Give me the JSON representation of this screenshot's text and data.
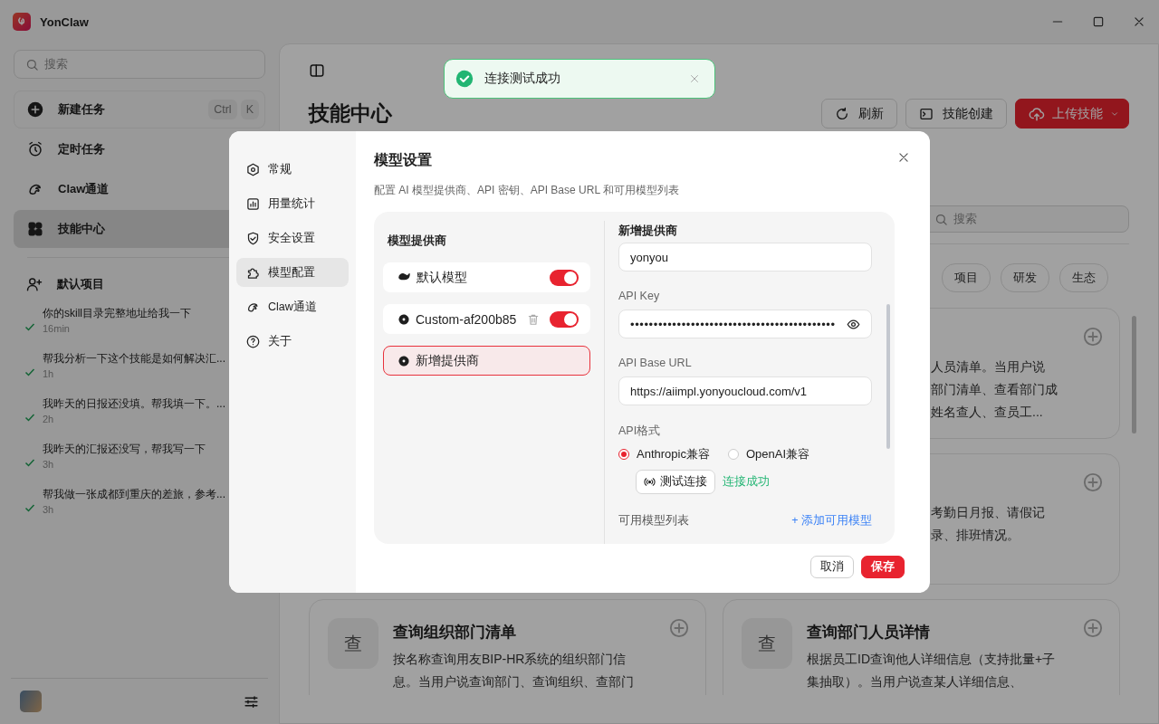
{
  "app": {
    "title": "YonClaw"
  },
  "toast": {
    "message": "连接测试成功"
  },
  "sidebar": {
    "search": {
      "placeholder": "搜索"
    },
    "nav": [
      {
        "label": "新建任务",
        "selected": false,
        "shortcut": [
          "Ctrl",
          "K"
        ]
      },
      {
        "label": "定时任务",
        "selected": false
      },
      {
        "label": "Claw通道",
        "selected": false
      },
      {
        "label": "技能中心",
        "selected": true
      }
    ],
    "project": "默认项目",
    "sessions": [
      {
        "title": "你的skill目录完整地址给我一下",
        "time": "16min",
        "done": true
      },
      {
        "title": "帮我分析一下这个技能是如何解决汇...",
        "time": "1h",
        "done": true
      },
      {
        "title": "我昨天的日报还没填。帮我填一下。...",
        "time": "2h",
        "done": true
      },
      {
        "title": "我昨天的汇报还没写，帮我写一下",
        "time": "3h",
        "done": true
      },
      {
        "title": "帮我做一张成都到重庆的差旅，参考...",
        "time": "3h",
        "done": true
      }
    ]
  },
  "skills": {
    "title": "技能中心",
    "buttons": [
      {
        "label": "刷新",
        "kind": "refresh"
      },
      {
        "label": "技能创建",
        "kind": "create"
      },
      {
        "label": "上传技能",
        "kind": "upload"
      }
    ],
    "search": {
      "placeholder": "搜索"
    },
    "filters": [
      {
        "label": "项目",
        "selected": false
      },
      {
        "label": "研发",
        "selected": false
      },
      {
        "label": "生态",
        "selected": false
      }
    ],
    "cards": [
      {
        "kind": "partial",
        "lines": [
          "人员清单。当用户说",
          "部门清单、查看部门成",
          "姓名查人、查员工..."
        ]
      },
      {
        "kind": "partial",
        "lines": [
          "考勤日月报、请假记",
          "录、排班情况。"
        ]
      },
      {
        "kind": "full",
        "icon": "查",
        "title": "查询组织部门清单",
        "description": "按名称查询用友BIP-HR系统的组织部门信息。当用户说查询部门、查询组织、查部门"
      },
      {
        "kind": "full",
        "icon": "查",
        "title": "查询部门人员详情",
        "description": "根据员工ID查询他人详细信息（支持批量+子集抽取）。当用户说查某人详细信息、"
      }
    ]
  },
  "settings": {
    "nav": [
      {
        "label": "常规",
        "selected": false
      },
      {
        "label": "用量统计",
        "selected": false
      },
      {
        "label": "安全设置",
        "selected": false
      },
      {
        "label": "模型配置",
        "selected": true
      },
      {
        "label": "Claw通道",
        "selected": false
      },
      {
        "label": "关于",
        "selected": false
      }
    ],
    "title": "模型设置",
    "description": "配置 AI 模型提供商、API 密钥、API Base URL 和可用模型列表",
    "providers_header": "模型提供商",
    "providers": [
      {
        "kind": "builtin",
        "name": "默认模型",
        "selected": false,
        "on": true
      },
      {
        "kind": "custom",
        "name": "Custom-af200b85",
        "selected": false,
        "on": true
      },
      {
        "kind": "draft",
        "name": "新增提供商",
        "selected": true
      }
    ],
    "form": {
      "header": "新增提供商",
      "name_value": "yonyou",
      "api_key": {
        "label": "API Key",
        "value": "••••••••••••••••••••••••••••••••••••••••••••"
      },
      "base_url": {
        "label": "API Base URL",
        "value": "https://aiimpl.yonyoucloud.com/v1"
      },
      "format": {
        "label": "API格式",
        "options": [
          {
            "label": "Anthropic兼容",
            "selected": true
          },
          {
            "label": "OpenAI兼容",
            "selected": false
          }
        ]
      },
      "test": {
        "button": "测试连接",
        "status": "连接成功"
      },
      "models": {
        "label": "可用模型列表",
        "add": "+ 添加可用模型"
      }
    },
    "buttons": [
      {
        "label": "取消",
        "kind": "secondary"
      },
      {
        "label": "保存",
        "kind": "primary"
      }
    ]
  }
}
